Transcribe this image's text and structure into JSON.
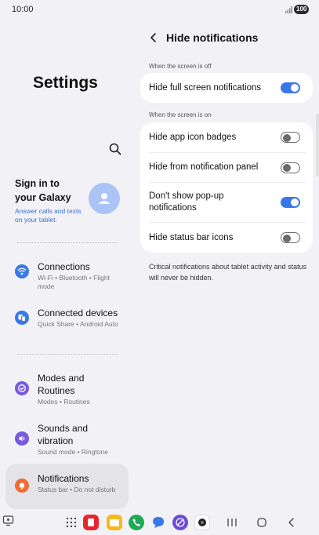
{
  "status_bar": {
    "time": "10:00",
    "battery": "100"
  },
  "left": {
    "title": "Settings",
    "account": {
      "title": "Sign in to your Galaxy",
      "subtitle": "Answer calls and texts on your tablet."
    },
    "items": [
      {
        "title": "Connections",
        "subtitle": "Wi-Fi • Bluetooth • Flight mode",
        "icon": "wifi-icon",
        "color": "#3a78e7"
      },
      {
        "title": "Connected devices",
        "subtitle": "Quick Share • Android Auto",
        "icon": "connected-devices-icon",
        "color": "#3a78e7"
      },
      {
        "title": "Modes and Routines",
        "subtitle": "Modes • Routines",
        "icon": "modes-icon",
        "color": "#7a5ae0"
      },
      {
        "title": "Sounds and vibration",
        "subtitle": "Sound mode • Ringtone",
        "icon": "sound-icon",
        "color": "#7a5ae0"
      },
      {
        "title": "Notifications",
        "subtitle": "Status bar • Do not disturb",
        "icon": "bell-icon",
        "color": "#f06b35"
      }
    ]
  },
  "right": {
    "title": "Hide notifications",
    "section_off": "When the screen is off",
    "section_on": "When the screen is on",
    "off_items": [
      {
        "label": "Hide full screen notifications",
        "on": true
      }
    ],
    "on_items": [
      {
        "label": "Hide app icon badges",
        "on": false
      },
      {
        "label": "Hide from notification panel",
        "on": false
      },
      {
        "label": "Don't show pop-up notifications",
        "on": true
      },
      {
        "label": "Hide status bar icons",
        "on": false
      }
    ],
    "note": "Critical notifications about tablet activity and status will never be hidden."
  },
  "nav": {
    "apps": [
      "apps-grid-icon",
      "flipboard-icon",
      "my-files-icon",
      "phone-icon",
      "messages-icon",
      "internet-icon",
      "camera-icon"
    ],
    "buttons": [
      "recents-button",
      "home-button",
      "back-button"
    ]
  },
  "colors": {
    "accent": "#3a78e7",
    "background": "#f2f2f6",
    "card": "#ffffff"
  }
}
